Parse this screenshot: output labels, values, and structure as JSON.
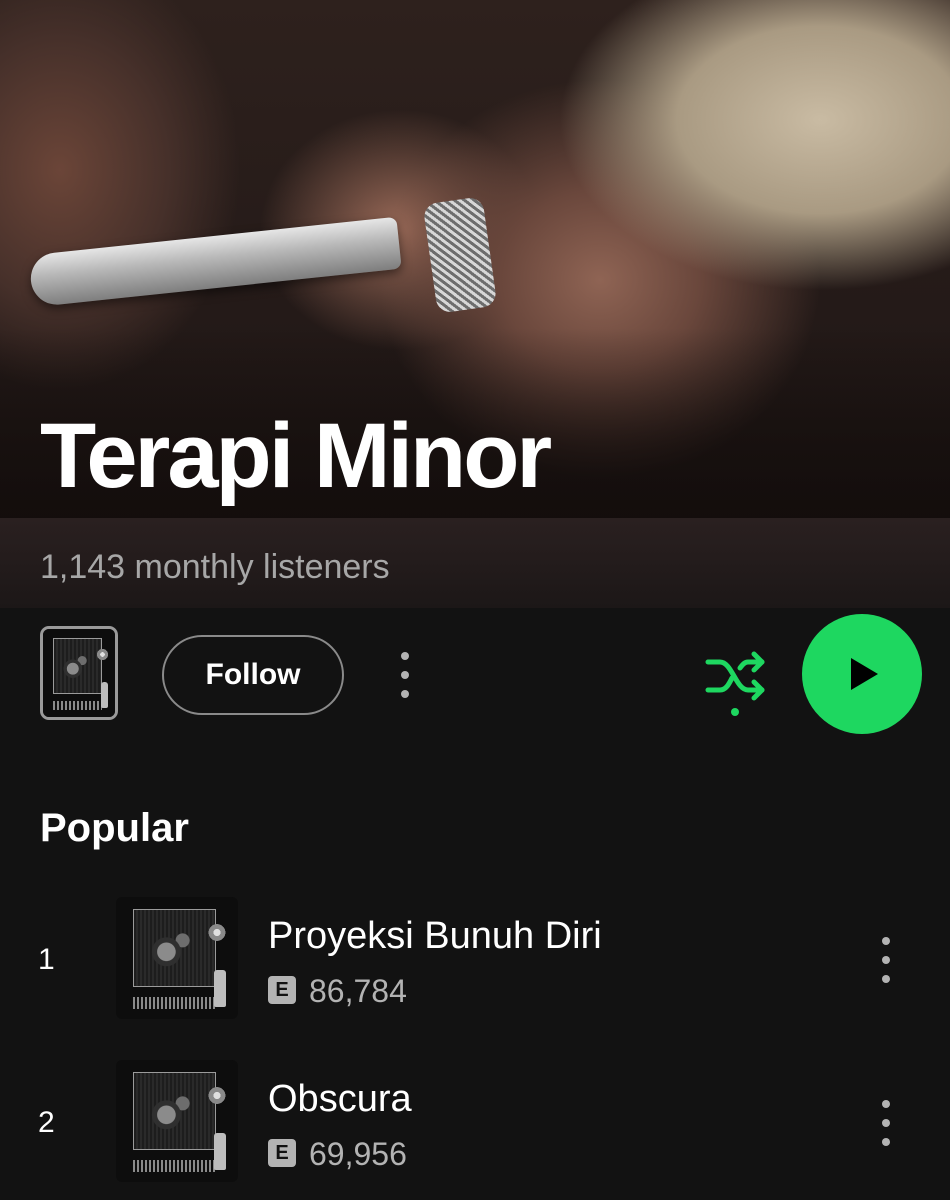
{
  "artist": {
    "name": "Terapi Minor",
    "monthly_listeners": "1,143 monthly listeners"
  },
  "actions": {
    "follow_label": "Follow",
    "more_icon": "more-vertical-icon",
    "shuffle_icon": "shuffle-icon",
    "play_icon": "play-icon"
  },
  "popular": {
    "title": "Popular",
    "tracks": [
      {
        "rank": "1",
        "name": "Proyeksi Bunuh Diri",
        "explicit": "E",
        "plays": "86,784"
      },
      {
        "rank": "2",
        "name": "Obscura",
        "explicit": "E",
        "plays": "69,956"
      }
    ]
  },
  "colors": {
    "background": "#121212",
    "accent_green": "#1ed760",
    "secondary_text": "#a7a7a7"
  }
}
